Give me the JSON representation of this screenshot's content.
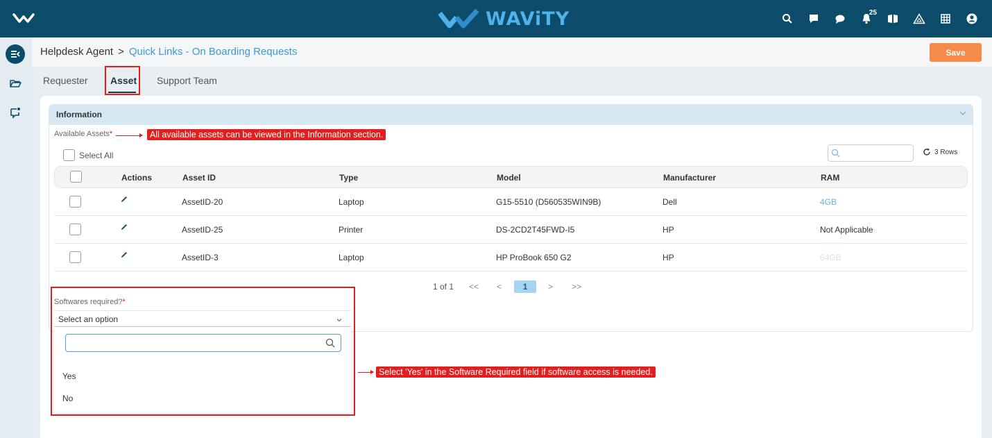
{
  "topbar": {
    "brand": "WAViTY",
    "notification_count": "25",
    "icons": [
      "search-icon",
      "chat-bubble-icon",
      "comment-icon",
      "bell-icon",
      "book-icon",
      "warning-triangle-icon",
      "grid-icon",
      "user-circle-icon"
    ],
    "color": "#0d4b6a"
  },
  "leftrail": {
    "icons": [
      "menu-collapse-icon",
      "folder-open-icon",
      "chat-notification-icon"
    ]
  },
  "header": {
    "breadcrumb_root": "Helpdesk Agent",
    "breadcrumb_separator": ">",
    "breadcrumb_current": "Quick Links - On Boarding Requests",
    "save_label": "Save",
    "save_color": "#f58a4b"
  },
  "tabs": [
    {
      "label": "Requester",
      "active": false
    },
    {
      "label": "Asset",
      "active": true
    },
    {
      "label": "Support Team",
      "active": false
    }
  ],
  "section": {
    "title": "Information",
    "available_assets_label": "Available Assets",
    "required_marker": "*",
    "annotation_assets": "All available assets can be viewed in the Information section.",
    "select_all_label": "Select All",
    "search_placeholder": "",
    "rows_count_label": "3 Rows",
    "columns": [
      "Actions",
      "Asset ID",
      "Type",
      "Model",
      "Manufacturer",
      "RAM"
    ],
    "rows": [
      {
        "asset_id": "AssetID-20",
        "type": "Laptop",
        "model": "G15-5510 (D560535WIN9B)",
        "manufacturer": "Dell",
        "ram": "4GB"
      },
      {
        "asset_id": "AssetID-25",
        "type": "Printer",
        "model": "DS-2CD2T45FWD-I5",
        "manufacturer": "HP",
        "ram": "Not Applicable"
      },
      {
        "asset_id": "AssetID-3",
        "type": "Laptop",
        "model": "HP ProBook 650 G2",
        "manufacturer": "HP",
        "ram": "64GB"
      }
    ],
    "pager": {
      "summary": "1 of 1",
      "first": "<<",
      "prev": "<",
      "current": "1",
      "next": ">",
      "last": ">>"
    }
  },
  "softwares": {
    "label": "Softwares required?",
    "required_marker": "*",
    "selected": "Select an option",
    "search_value": "",
    "options": [
      "Yes",
      "No"
    ],
    "annotation": "Select 'Yes' in the Software Required field if software access is needed."
  },
  "annotation_color": "#e21e1e"
}
